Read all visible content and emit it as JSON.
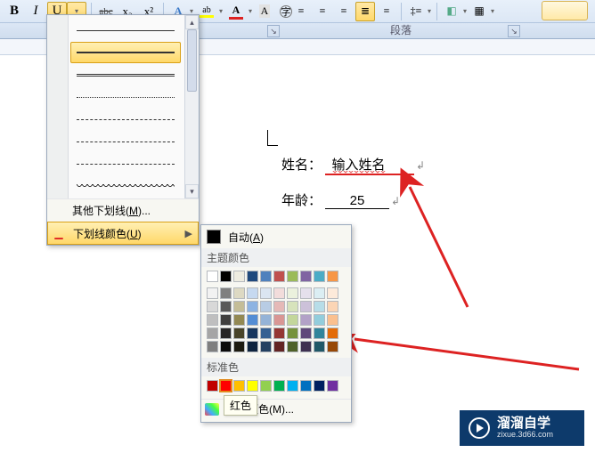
{
  "ribbon": {
    "bold": "B",
    "italic": "I",
    "underline": "U",
    "strike": "abc",
    "sub": "x₂",
    "sup": "x²",
    "font_a": "A",
    "highlight_a": "ab",
    "font_color_a": "A",
    "underline_colors": {
      "selected": "red",
      "bar": "#d22"
    }
  },
  "ribbon_groups": {
    "paragraph": "段落"
  },
  "underline_menu": {
    "more": "其他下划线(M)...",
    "color": "下划线颜色(U)",
    "more_key": "M",
    "color_key": "U"
  },
  "color_picker": {
    "auto": "自动(A)",
    "auto_key": "A",
    "theme": "主题颜色",
    "standard": "标准色",
    "more": "其他颜色(M)...",
    "tooltip": "红色",
    "theme_colors_row0": [
      "#ffffff",
      "#000000",
      "#eeece1",
      "#1f497d",
      "#4f81bd",
      "#c0504d",
      "#9bbb59",
      "#8064a2",
      "#4bacc6",
      "#f79646"
    ],
    "theme_shades": [
      [
        "#f2f2f2",
        "#7f7f7f",
        "#ddd9c3",
        "#c6d9f0",
        "#dbe5f1",
        "#f2dcdb",
        "#ebf1dd",
        "#e5e0ec",
        "#dbeef3",
        "#fdeada"
      ],
      [
        "#d8d8d8",
        "#595959",
        "#c4bd97",
        "#8db3e2",
        "#b8cce4",
        "#e5b9b7",
        "#d7e3bc",
        "#ccc1d9",
        "#b7dde8",
        "#fbd5b5"
      ],
      [
        "#bfbfbf",
        "#3f3f3f",
        "#938953",
        "#548dd4",
        "#95b3d7",
        "#d99694",
        "#c3d69b",
        "#b2a2c7",
        "#92cddc",
        "#fac08f"
      ],
      [
        "#a5a5a5",
        "#262626",
        "#494429",
        "#17365d",
        "#366092",
        "#953734",
        "#76923c",
        "#5f497a",
        "#31859b",
        "#e36c09"
      ],
      [
        "#7f7f7f",
        "#0c0c0c",
        "#1d1b10",
        "#0f243e",
        "#244061",
        "#632423",
        "#4f6128",
        "#3f3151",
        "#205867",
        "#974806"
      ]
    ],
    "standard_colors": [
      "#c00000",
      "#ff0000",
      "#ffc000",
      "#ffff00",
      "#92d050",
      "#00b050",
      "#00b0f0",
      "#0070c0",
      "#002060",
      "#7030a0"
    ]
  },
  "document": {
    "line1_label": "姓名：",
    "line1_value": "输入姓名",
    "line2_label": "年龄：",
    "line2_value": "25",
    "return_mark": "↲"
  },
  "watermark": {
    "title": "溜溜自学",
    "sub": "zixue.3d66.com"
  }
}
